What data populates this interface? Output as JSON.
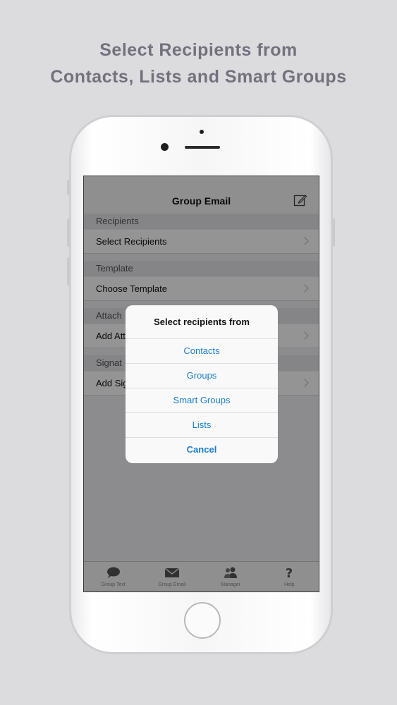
{
  "promo": {
    "line1": "Select Recipients from",
    "line2": "Contacts, Lists and Smart Groups"
  },
  "navbar": {
    "title": "Group Email",
    "compose_icon": "compose-icon"
  },
  "sections": [
    {
      "header": "Recipients",
      "row": "Select Recipients"
    },
    {
      "header": "Template",
      "row": "Choose Template"
    },
    {
      "header": "Attach",
      "row": "Add Att"
    },
    {
      "header": "Signat",
      "row": "Add Sig"
    }
  ],
  "tabbar": {
    "tabs": [
      {
        "label": "Group Text",
        "icon": "chat-bubble-icon"
      },
      {
        "label": "Group Email",
        "icon": "envelope-icon"
      },
      {
        "label": "Manager",
        "icon": "people-icon"
      },
      {
        "label": "Help",
        "icon": "question-mark-icon"
      }
    ]
  },
  "action_sheet": {
    "title": "Select recipients from",
    "options": [
      "Contacts",
      "Groups",
      "Smart Groups",
      "Lists"
    ],
    "cancel": "Cancel"
  },
  "colors": {
    "background": "#dcdcde",
    "promo_text": "#74717f",
    "accent": "#1a7fd4"
  }
}
